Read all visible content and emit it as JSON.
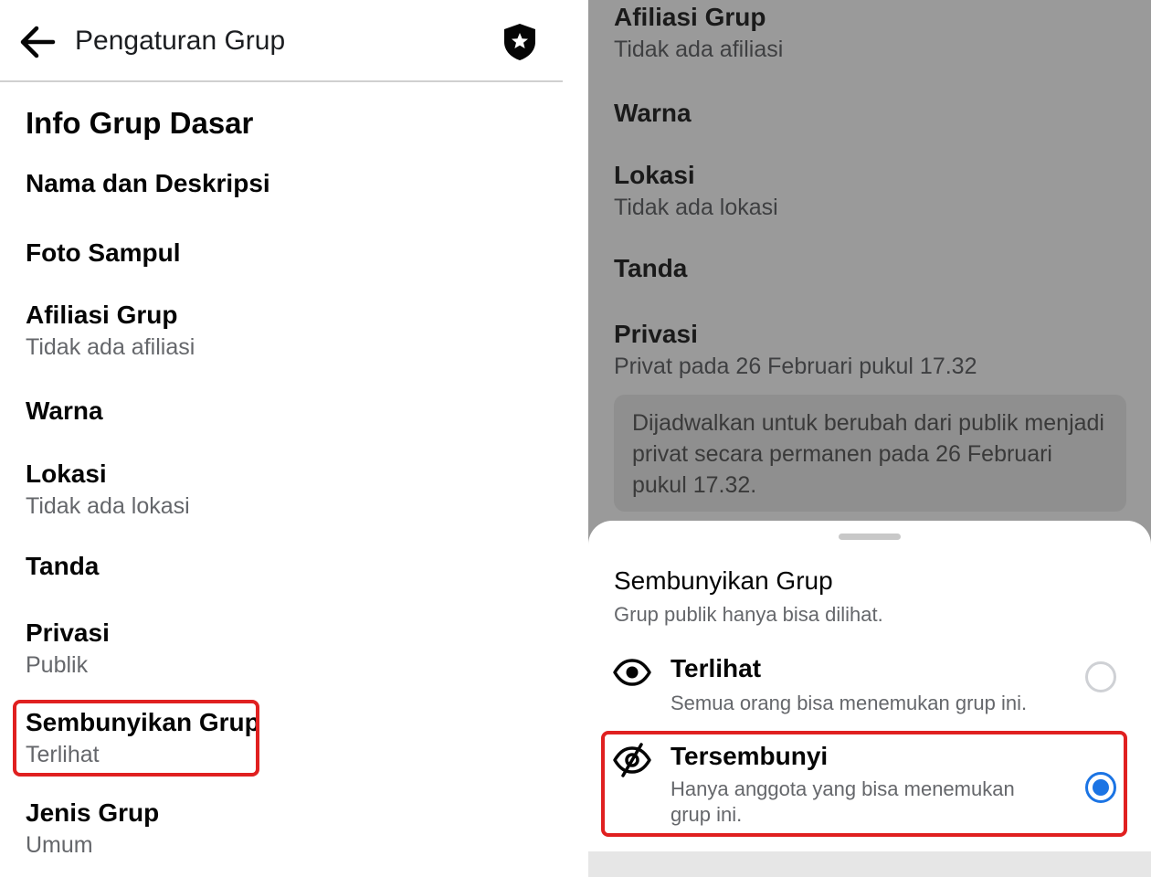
{
  "left": {
    "header": {
      "title": "Pengaturan Grup"
    },
    "section_title": "Info Grup Dasar",
    "items": [
      {
        "title": "Nama dan Deskripsi",
        "subtitle": ""
      },
      {
        "title": "Foto Sampul",
        "subtitle": ""
      },
      {
        "title": "Afiliasi Grup",
        "subtitle": "Tidak ada afiliasi"
      },
      {
        "title": "Warna",
        "subtitle": ""
      },
      {
        "title": "Lokasi",
        "subtitle": "Tidak ada lokasi"
      },
      {
        "title": "Tanda",
        "subtitle": ""
      },
      {
        "title": "Privasi",
        "subtitle": "Publik"
      },
      {
        "title": "Sembunyikan Grup",
        "subtitle": "Terlihat"
      },
      {
        "title": "Jenis Grup",
        "subtitle": "Umum"
      }
    ]
  },
  "right": {
    "items": [
      {
        "title": "Afiliasi Grup",
        "subtitle": "Tidak ada afiliasi"
      },
      {
        "title": "Warna",
        "subtitle": ""
      },
      {
        "title": "Lokasi",
        "subtitle": "Tidak ada lokasi"
      },
      {
        "title": "Tanda",
        "subtitle": ""
      },
      {
        "title": "Privasi",
        "subtitle": "Privat pada 26 Februari pukul 17.32"
      }
    ],
    "notice": "Dijadwalkan untuk berubah dari publik menjadi privat secara permanen pada 26 Februari pukul 17.32.",
    "sheet": {
      "title": "Sembunyikan Grup",
      "subtitle": "Grup publik hanya bisa dilihat.",
      "options": [
        {
          "label": "Terlihat",
          "description": "Semua orang bisa menemukan grup ini.",
          "selected": false,
          "icon": "eye-icon"
        },
        {
          "label": "Tersembunyi",
          "description": "Hanya anggota yang bisa menemukan grup ini.",
          "selected": true,
          "icon": "eye-off-icon"
        }
      ]
    }
  },
  "colors": {
    "accent": "#1b74e4",
    "highlight": "#e02020",
    "overlay": "#9a9a9a"
  }
}
